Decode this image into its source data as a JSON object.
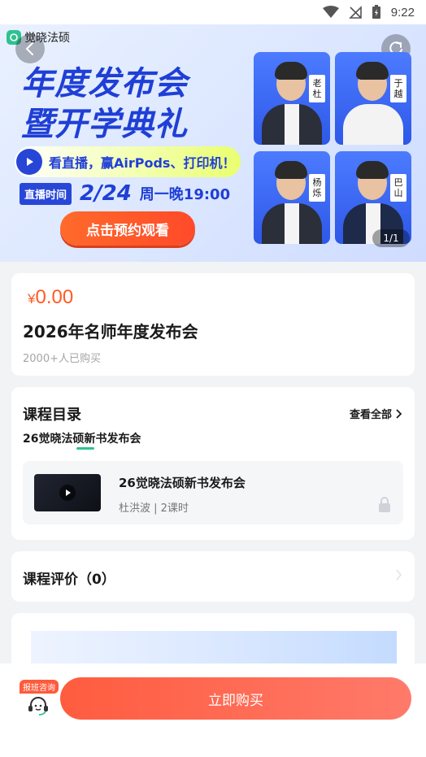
{
  "status_bar": {
    "time": "9:22"
  },
  "banner": {
    "app_name": "觉晓法硕",
    "title_line1": "年度发布会",
    "title_line2": "暨开学典礼",
    "promo_text": "看直播，赢AirPods、打印机！",
    "live_tag": "直播时间",
    "live_date": "2/24",
    "live_time": "周一晚19:00",
    "reserve_button": "点击预约观看",
    "teachers": [
      "老杜",
      "于越",
      "杨烁",
      "巴山"
    ],
    "pager": "1/1"
  },
  "product": {
    "currency": "¥",
    "price": "0.00",
    "title": "2026年名师年度发布会",
    "buyers": "2000+人已购买"
  },
  "catalog": {
    "heading": "课程目录",
    "see_all": "查看全部",
    "chapter": "26觉晓法硕新书发布会",
    "lesson": {
      "title": "26觉晓法硕新书发布会",
      "meta": "杜洪波 | 2课时"
    }
  },
  "review": {
    "title": "课程评价（0）"
  },
  "bottom_bar": {
    "consult_badge": "报班咨询",
    "buy_button": "立即购买"
  },
  "colors": {
    "accent_orange": "#ff5a23",
    "brand_green": "#2fc28f",
    "banner_blue": "#1f3fd6",
    "buy_button": "#ff6a55"
  }
}
